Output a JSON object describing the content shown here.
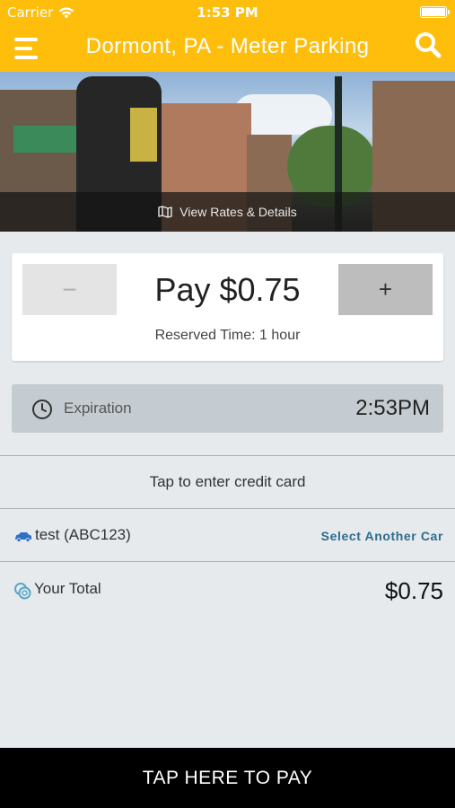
{
  "status_bar": {
    "carrier": "Carrier",
    "time": "1:53 PM",
    "battery": 1.0
  },
  "header": {
    "title": "Dormont, PA - Meter Parking",
    "menu_icon": "hamburger-menu-icon",
    "search_icon": "search-icon"
  },
  "hero": {
    "caption": "View Rates & Details",
    "caption_icon": "map-icon"
  },
  "pay": {
    "minus_label": "−",
    "plus_label": "+",
    "amount_text": "Pay $0.75",
    "reserved_text": "Reserved Time: 1 hour"
  },
  "expiration": {
    "label": "Expiration",
    "value": "2:53PM",
    "icon": "clock-icon"
  },
  "credit": {
    "label": "Tap to enter credit card"
  },
  "car": {
    "name": "test (ABC123)",
    "select_label": "Select Another Car",
    "icon": "car-icon"
  },
  "total": {
    "label": "Your Total",
    "value": "$0.75",
    "icon": "coins-icon"
  },
  "footer": {
    "pay_label": "TAP HERE TO PAY"
  },
  "colors": {
    "brand": "#ffbe0b",
    "link": "#2e6b8e",
    "background": "#e6eaed",
    "footer": "#000000"
  }
}
